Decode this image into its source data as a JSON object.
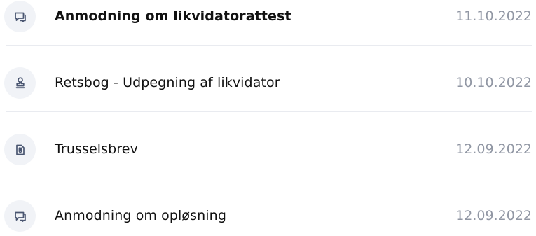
{
  "documents": [
    {
      "icon": "chat-icon",
      "title": "Anmodning om likvidatorattest",
      "date": "11.10.2022"
    },
    {
      "icon": "stamp-icon",
      "title": "Retsbog - Udpegning af likvidator",
      "date": "10.10.2022"
    },
    {
      "icon": "attachment-icon",
      "title": "Trusselsbrev",
      "date": "12.09.2022"
    },
    {
      "icon": "chat-icon",
      "title": "Anmodning om opløsning",
      "date": "12.09.2022"
    }
  ],
  "colors": {
    "title": "#111111",
    "date": "#9197a4",
    "icon": "#4a5671",
    "icon_background": "#f1f3f7",
    "divider": "#e9ebf0"
  }
}
